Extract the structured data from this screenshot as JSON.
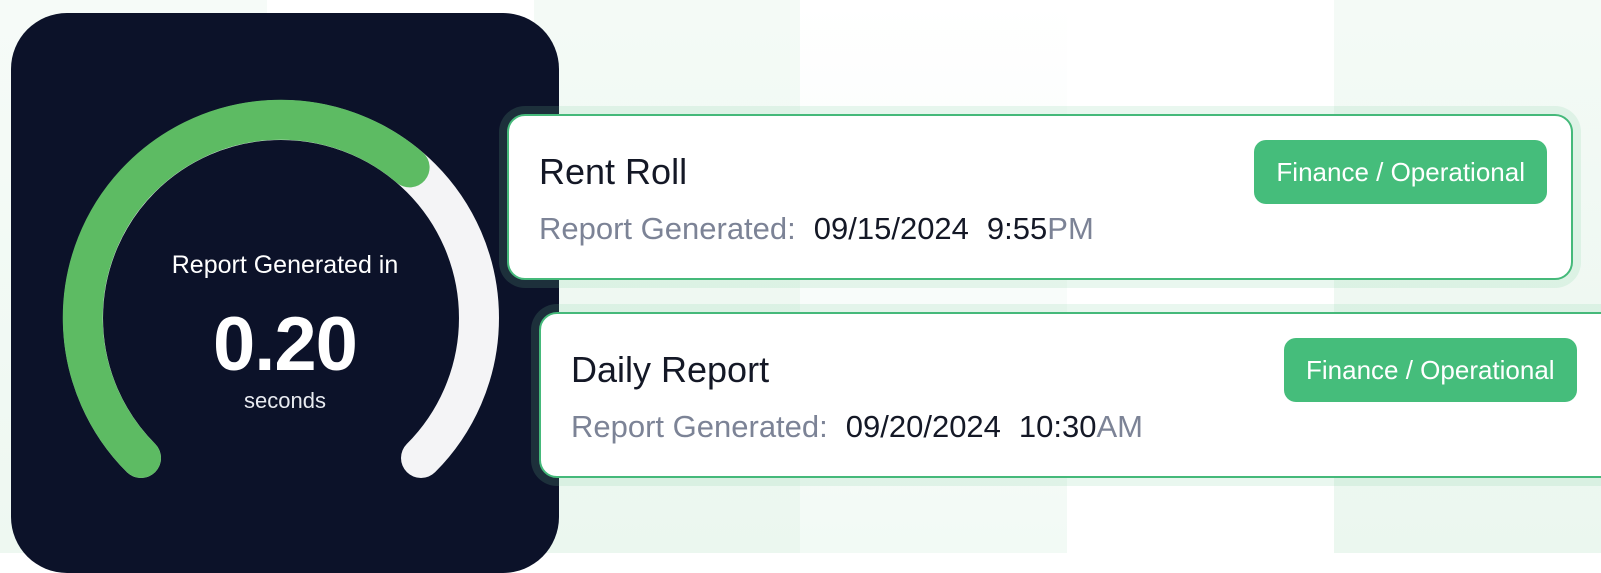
{
  "gauge": {
    "caption": "Report Generated in",
    "value": "0.20",
    "unit": "seconds",
    "fill_fraction": 0.65,
    "colors": {
      "background": "#0c1229",
      "fill": "#5dbb63",
      "track": "#f4f4f6"
    }
  },
  "reports": [
    {
      "title": "Rent Roll",
      "meta_label": "Report Generated:",
      "date": "09/15/2024",
      "time": "9:55",
      "ampm": "PM",
      "tag": "Finance / Operational"
    },
    {
      "title": "Daily Report",
      "meta_label": "Report Generated:",
      "date": "09/20/2024",
      "time": "10:30",
      "ampm": "AM",
      "tag": "Finance / Operational"
    }
  ],
  "colors": {
    "accent": "#45bd7b",
    "card_border": "#45b97a",
    "muted_text": "#7c8396",
    "text": "#141826"
  }
}
